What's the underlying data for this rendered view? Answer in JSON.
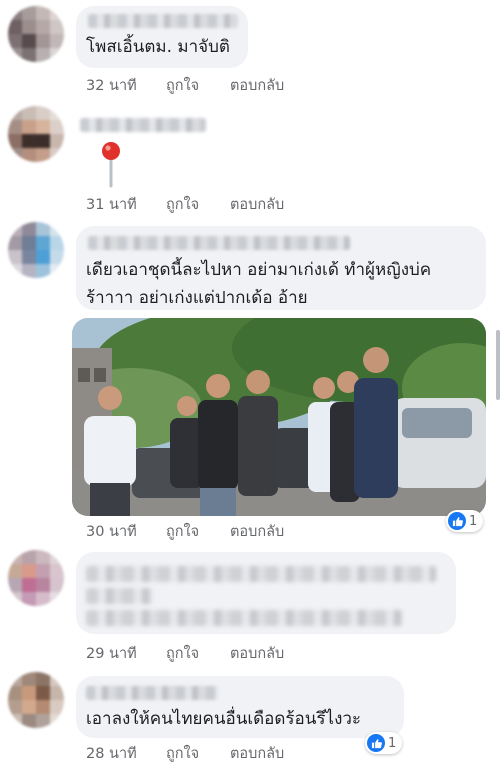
{
  "comments": [
    {
      "text_lines": [
        "โพสเอิ้นตม. มาจับติ"
      ],
      "time": "32 นาที",
      "like_label": "ถูกใจ",
      "reply_label": "ตอบกลับ"
    },
    {
      "sticker": "red-pushpin",
      "time": "31 นาที",
      "like_label": "ถูกใจ",
      "reply_label": "ตอบกลับ"
    },
    {
      "text_lines": [
        "เดียวเอาชุดนี้ละไปหา อย่ามาเก่งเด้ ทำผู้หญิงบ่ค",
        "ร้าาาา อย่าเก่งแต่ปากเด้อ อ้าย"
      ],
      "photo": "street scene: group of men standing beside parked cars under trees",
      "time": "30 นาที",
      "like_label": "ถูกใจ",
      "reply_label": "ตอบกลับ",
      "reaction_count": "1"
    },
    {
      "time": "29 นาที",
      "like_label": "ถูกใจ",
      "reply_label": "ตอบกลับ"
    },
    {
      "text_lines": [
        "เอาลงให้คนไทยคนอื่นเดือดร้อนรึไงวะ"
      ],
      "time": "28 นาที",
      "like_label": "ถูกใจ",
      "reply_label": "ตอบกลับ",
      "reaction_count": "1"
    }
  ],
  "colors": {
    "bubble": "#f0f2f5",
    "meta_text": "#65676b",
    "like_blue": "#1877f2"
  }
}
